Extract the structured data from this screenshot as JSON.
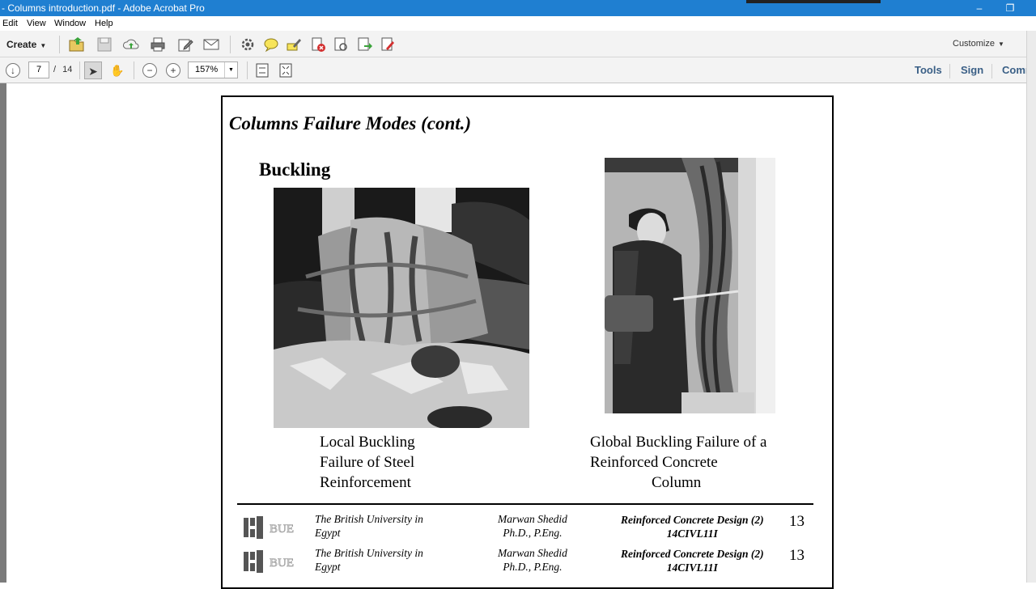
{
  "window": {
    "title": "- Columns introduction.pdf - Adobe Acrobat Pro",
    "minimize_glyph": "–",
    "restore_glyph": "❐"
  },
  "menu": {
    "items": [
      "Edit",
      "View",
      "Window",
      "Help"
    ]
  },
  "toolbar": {
    "create_label": "Create",
    "customize_label": "Customize",
    "icons": [
      "open-icon",
      "save-icon",
      "upload-icon",
      "print-icon",
      "edit-icon",
      "email-icon",
      "gear-icon",
      "comment-icon",
      "highlight-icon",
      "delete-icon",
      "document-icon",
      "export-icon",
      "sign-doc-icon"
    ]
  },
  "navbar": {
    "current_page": "7",
    "page_separator": "/",
    "total_pages": "14",
    "zoom": "157%",
    "tools_label": "Tools",
    "sign_label": "Sign",
    "comment_label": "Comm"
  },
  "slide": {
    "title": "Columns Failure Modes (cont.)",
    "subheading": "Buckling",
    "caption_left": [
      "Local Buckling",
      "Failure of Steel",
      "Reinforcement"
    ],
    "caption_right": [
      "Global Buckling Failure of a",
      "Reinforced Concrete",
      "Column"
    ],
    "footer": [
      {
        "university": [
          "The British University in",
          "Egypt"
        ],
        "author": [
          "Marwan Shedid",
          "Ph.D., P.Eng."
        ],
        "course": [
          "Reinforced Concrete Design (2)",
          "14CIVL11I"
        ],
        "page": "13"
      },
      {
        "university": [
          "The British University in",
          "Egypt"
        ],
        "author": [
          "Marwan Shedid",
          "Ph.D., P.Eng."
        ],
        "course": [
          "Reinforced Concrete Design (2)",
          "14CIVL11I"
        ],
        "page": "13"
      }
    ],
    "logo_text": "BUE"
  }
}
